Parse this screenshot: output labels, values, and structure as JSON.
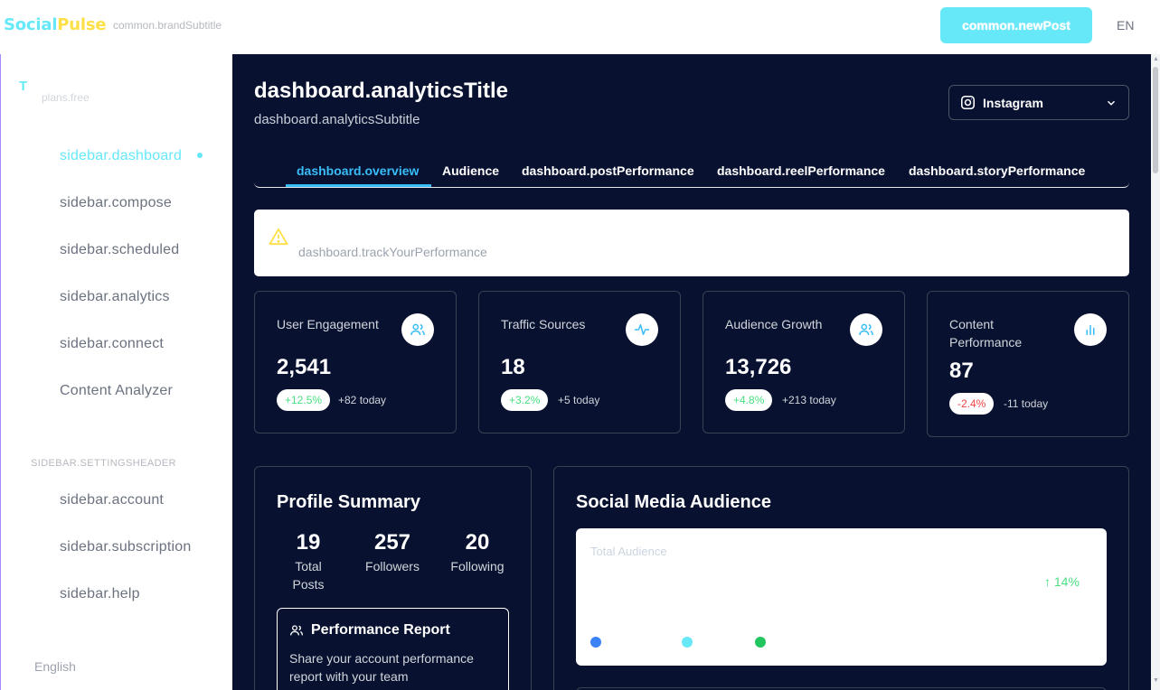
{
  "topbar": {
    "brand_part1": "Social",
    "brand_part2": "Pulse",
    "brand_subtitle": "common.brandSubtitle",
    "new_post_label": "common.newPost",
    "language_code": "EN"
  },
  "sidebar": {
    "avatar_letter": "T",
    "plan": "plans.free",
    "items": [
      {
        "label": "sidebar.dashboard",
        "active": true
      },
      {
        "label": "sidebar.compose"
      },
      {
        "label": "sidebar.scheduled"
      },
      {
        "label": "sidebar.analytics"
      },
      {
        "label": "sidebar.connect"
      },
      {
        "label": "Content Analyzer"
      }
    ],
    "settings_header": "SIDEBAR.SETTINGSHEADER",
    "settings_items": [
      {
        "label": "sidebar.account"
      },
      {
        "label": "sidebar.subscription"
      },
      {
        "label": "sidebar.help"
      }
    ],
    "language": "English"
  },
  "main": {
    "title": "dashboard.analyticsTitle",
    "subtitle": "dashboard.analyticsSubtitle",
    "platform": {
      "selected": "Instagram",
      "icon": "instagram-icon"
    },
    "tabs": [
      {
        "label": "dashboard.overview",
        "active": true
      },
      {
        "label": "Audience"
      },
      {
        "label": "dashboard.postPerformance"
      },
      {
        "label": "dashboard.reelPerformance"
      },
      {
        "label": "dashboard.storyPerformance"
      }
    ],
    "alert": {
      "text": "dashboard.trackYourPerformance",
      "icon": "warning-icon"
    },
    "stats": [
      {
        "label": "User Engagement",
        "value": "2,541",
        "change": "+12.5%",
        "today": "+82 today",
        "trend": "up",
        "icon": "users-icon"
      },
      {
        "label": "Traffic Sources",
        "value": "18",
        "change": "+3.2%",
        "today": "+5 today",
        "trend": "up",
        "icon": "activity-icon"
      },
      {
        "label": "Audience Growth",
        "value": "13,726",
        "change": "+4.8%",
        "today": "+213 today",
        "trend": "up",
        "icon": "users-icon"
      },
      {
        "label": "Content Performance",
        "value": "87",
        "change": "-2.4%",
        "today": "-11 today",
        "trend": "down",
        "icon": "bar-chart-icon"
      }
    ],
    "profile_summary": {
      "title": "Profile Summary",
      "metrics": [
        {
          "value": "19",
          "caption": "Total Posts"
        },
        {
          "value": "257",
          "caption": "Followers"
        },
        {
          "value": "20",
          "caption": "Following"
        }
      ],
      "report": {
        "title": "Performance Report",
        "description": "Share your account performance report with your team"
      }
    },
    "social_audience": {
      "title": "Social Media Audience",
      "label": "Total Audience",
      "change": "↑ 14%",
      "legend_colors": [
        "#3b82f6",
        "#67e8f9",
        "#22c55e"
      ]
    }
  },
  "colors": {
    "main_bg": "#081230",
    "accent_cyan": "#67e8f9",
    "accent_yellow": "#fde047",
    "tab_active": "#38bdf8",
    "positive": "#4ade80",
    "negative": "#ef4444"
  }
}
